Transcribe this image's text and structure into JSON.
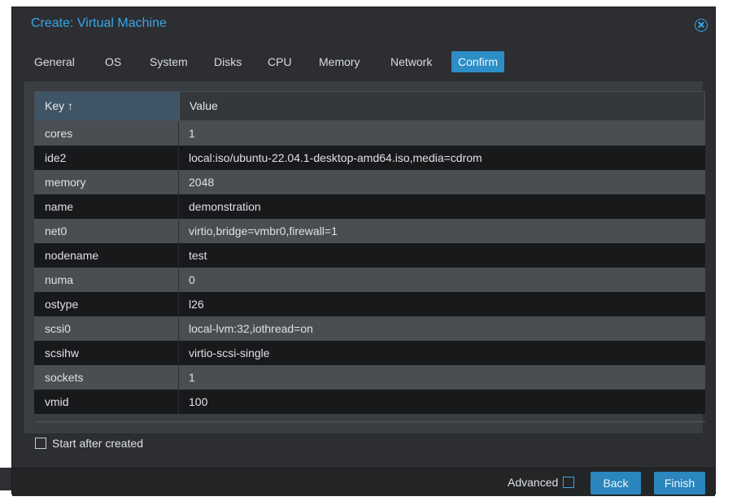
{
  "dialog": {
    "title": "Create: Virtual Machine"
  },
  "tabs": [
    {
      "label": "General"
    },
    {
      "label": "OS"
    },
    {
      "label": "System"
    },
    {
      "label": "Disks"
    },
    {
      "label": "CPU"
    },
    {
      "label": "Memory"
    },
    {
      "label": "Network"
    },
    {
      "label": "Confirm",
      "active": true
    }
  ],
  "table": {
    "columns": [
      "Key ↑",
      "Value"
    ],
    "rows": [
      {
        "key": "cores",
        "value": "1"
      },
      {
        "key": "ide2",
        "value": "local:iso/ubuntu-22.04.1-desktop-amd64.iso,media=cdrom"
      },
      {
        "key": "memory",
        "value": "2048"
      },
      {
        "key": "name",
        "value": "demonstration"
      },
      {
        "key": "net0",
        "value": "virtio,bridge=vmbr0,firewall=1"
      },
      {
        "key": "nodename",
        "value": "test"
      },
      {
        "key": "numa",
        "value": "0"
      },
      {
        "key": "ostype",
        "value": "l26"
      },
      {
        "key": "scsi0",
        "value": "local-lvm:32,iothread=on"
      },
      {
        "key": "scsihw",
        "value": "virtio-scsi-single"
      },
      {
        "key": "sockets",
        "value": "1"
      },
      {
        "key": "vmid",
        "value": "100"
      }
    ]
  },
  "options": {
    "start_after_created_label": "Start after created",
    "start_after_created_checked": false,
    "advanced_label": "Advanced",
    "advanced_checked": false
  },
  "buttons": {
    "back_label": "Back",
    "finish_label": "Finish"
  },
  "colors": {
    "accent": "#3aa6e8",
    "button": "#2a86bd",
    "dialog_bg": "#2c2e31"
  },
  "icons": {
    "close": "close-circle-icon"
  }
}
